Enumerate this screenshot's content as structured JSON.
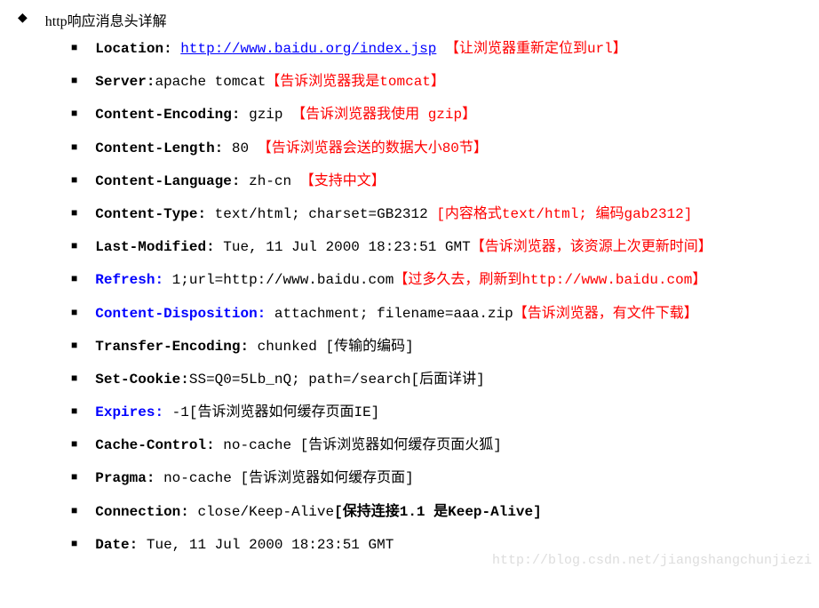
{
  "title": "http响应消息头详解",
  "items": [
    {
      "header": "Location:",
      "headerClass": "bold",
      "value": " ",
      "link": "http://www.baidu.org/index.jsp",
      "note": "【让浏览器重新定位到url】"
    },
    {
      "header": "Server:",
      "headerClass": "bold",
      "value": "apache tomcat",
      "note": "【告诉浏览器我是tomcat】"
    },
    {
      "header": "Content-Encoding:",
      "headerClass": "bold",
      "value": " gzip ",
      "note": "【告诉浏览器我使用 gzip】"
    },
    {
      "header": "Content-Length:",
      "headerClass": "bold",
      "value": " 80 ",
      "note": "【告诉浏览器会送的数据大小80节】"
    },
    {
      "header": "Content-Language:",
      "headerClass": "bold",
      "value": " zh-cn ",
      "note": "【支持中文】"
    },
    {
      "header": "Content-Type:",
      "headerClass": "bold",
      "value": " text/html; charset=GB2312 ",
      "note": "[内容格式text/html; 编码gab2312]"
    },
    {
      "header": "Last-Modified:",
      "headerClass": "bold",
      "value": " Tue, 11 Jul 2000 18:23:51 GMT",
      "note": "【告诉浏览器，该资源上次更新时间】"
    },
    {
      "header": "Refresh:",
      "headerClass": "blue-bold",
      "value": " 1;url=http://www.baidu.com",
      "note": "【过多久去，刷新到http://www.baidu.com】"
    },
    {
      "header": "Content-Disposition:",
      "headerClass": "blue-bold",
      "value": " attachment; filename=aaa.zip",
      "note": "【告诉浏览器，有文件下载】"
    },
    {
      "header": "Transfer-Encoding:",
      "headerClass": "bold",
      "value": " chunked  ",
      "note2": "[传输的编码]"
    },
    {
      "header": "Set-Cookie:",
      "headerClass": "bold",
      "value": "SS=Q0=5Lb_nQ; path=/search",
      "note2": "[后面详讲]"
    },
    {
      "header": "Expires:",
      "headerClass": "blue-bold",
      "value": " -1",
      "note2": "[告诉浏览器如何缓存页面IE]"
    },
    {
      "header": "Cache-Control:",
      "headerClass": "bold",
      "value": " no-cache  ",
      "note2": "[告诉浏览器如何缓存页面火狐]"
    },
    {
      "header": "Pragma:",
      "headerClass": "bold",
      "value": " no-cache   ",
      "note2": "[告诉浏览器如何缓存页面]"
    },
    {
      "header": "Connection:",
      "headerClass": "bold",
      "value": " close/Keep-Alive",
      "boldnote": "[保持连接1.1 是Keep-Alive]"
    },
    {
      "header": "Date:",
      "headerClass": "bold",
      "value": " Tue, 11 Jul 2000 18:23:51 GMT"
    }
  ],
  "watermark": "http://blog.csdn.net/jiangshangchunjiezi"
}
